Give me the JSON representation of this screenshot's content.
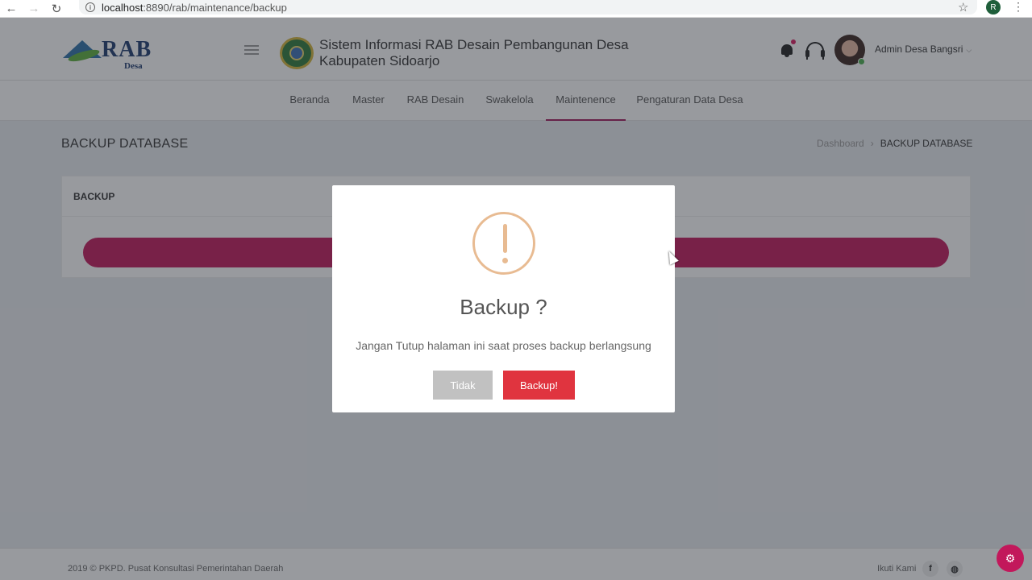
{
  "browser": {
    "url_host": "localhost",
    "url_path": ":8890/rab/maintenance/backup",
    "profile_initial": "R",
    "icons": [
      "back-arrow-icon",
      "forward-arrow-icon",
      "reload-icon",
      "info-icon",
      "star-icon",
      "kebab-menu-icon"
    ]
  },
  "header": {
    "logo_text": "RAB",
    "logo_sub": "Desa",
    "title_line1": "Sistem Informasi RAB Desain Pembangunan Desa",
    "title_line2": "Kabupaten Sidoarjo",
    "user_name": "Admin Desa Bangsri",
    "caret": "⌵"
  },
  "nav": {
    "items": [
      {
        "label": "Beranda",
        "active": false
      },
      {
        "label": "Master",
        "active": false
      },
      {
        "label": "RAB Desain",
        "active": false
      },
      {
        "label": "Swakelola",
        "active": false
      },
      {
        "label": "Maintenence",
        "active": true
      },
      {
        "label": "Pengaturan Data Desa",
        "active": false
      }
    ]
  },
  "page": {
    "title": "BACKUP DATABASE",
    "breadcrumb": [
      "Dashboard",
      "BACKUP DATABASE"
    ],
    "breadcrumb_sep": "›",
    "card_title": "BACKUP"
  },
  "modal": {
    "title": "Backup ?",
    "text": "Jangan Tutup halaman ini saat proses backup berlangsung",
    "cancel_label": "Tidak",
    "confirm_label": "Backup!"
  },
  "footer": {
    "copyright": "2019 © PKPD. Pusat Konsultasi Pemerintahan Daerah",
    "follow": "Ikuti Kami",
    "facebook": "f",
    "web": "◍"
  },
  "colors": {
    "accent": "#c2185b",
    "confirm": "#e0343f",
    "cancel": "#c1c1c1",
    "warning": "#e8bb92"
  }
}
